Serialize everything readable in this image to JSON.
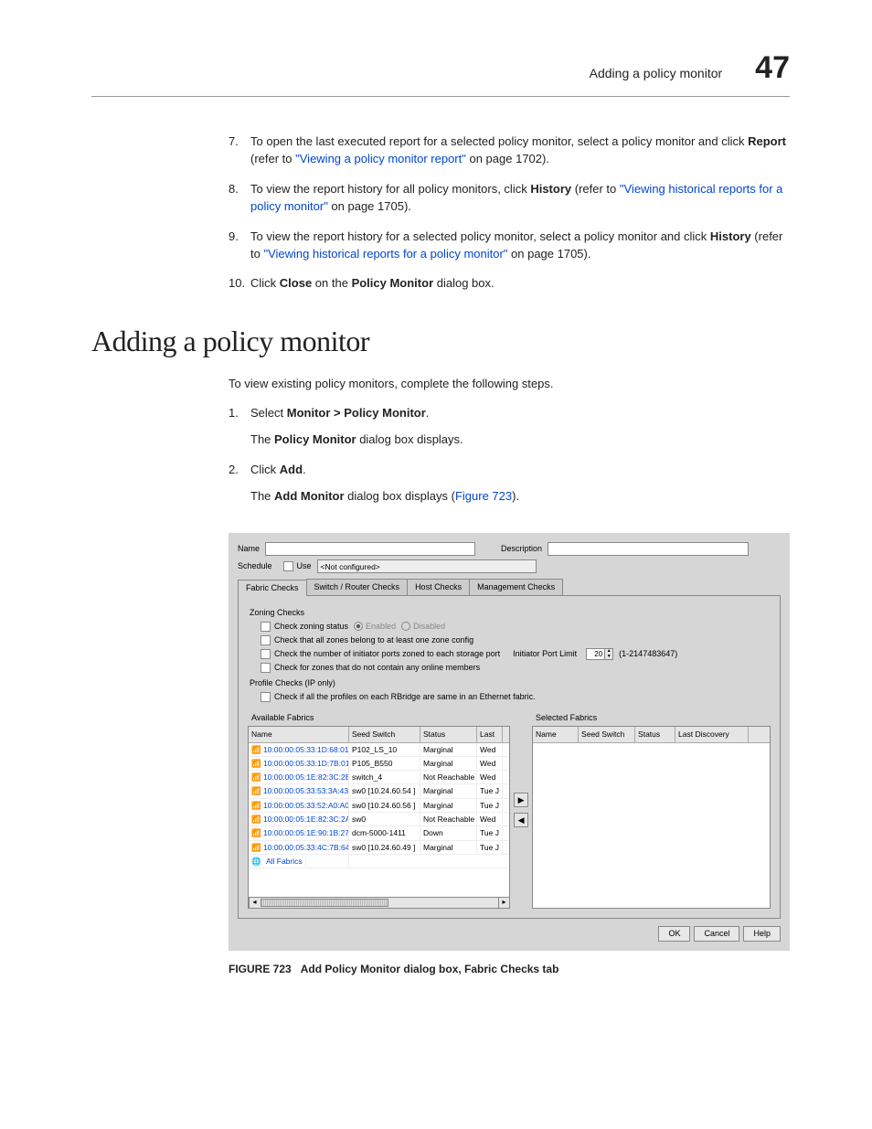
{
  "header": {
    "title": "Adding a policy monitor",
    "chapter": "47"
  },
  "steps_a": [
    {
      "num": "7.",
      "pre": "To open the last executed report for a selected policy monitor, select a policy monitor and click ",
      "b1": "Report",
      "mid": " (refer to ",
      "link": "\"Viewing a policy monitor report\"",
      "post": " on page 1702)."
    },
    {
      "num": "8.",
      "pre": "To view the report history for all policy monitors, click ",
      "b1": "History",
      "mid": " (refer to ",
      "link": "\"Viewing historical reports for a policy monitor\"",
      "post": " on page 1705)."
    },
    {
      "num": "9.",
      "pre": "To view the report history for a selected policy monitor, select a policy monitor and click ",
      "b1": "History",
      "mid": " (refer to ",
      "link": "\"Viewing historical reports for a policy monitor\"",
      "post": " on page 1705)."
    },
    {
      "num": "10.",
      "pre": "Click ",
      "b1": "Close",
      "mid": " on the ",
      "b2": "Policy Monitor",
      "post": " dialog box."
    }
  ],
  "section_title": "Adding a policy monitor",
  "intro": "To view existing policy monitors, complete the following steps.",
  "steps_b": [
    {
      "num": "1.",
      "pre": "Select ",
      "b1": "Monitor > Policy Monitor",
      "post": ".",
      "sub_pre": "The ",
      "sub_b": "Policy Monitor",
      "sub_post": " dialog box displays."
    },
    {
      "num": "2.",
      "pre": "Click ",
      "b1": "Add",
      "post": ".",
      "sub_pre": "The ",
      "sub_b": "Add Monitor",
      "sub_mid": " dialog box displays (",
      "sub_link": "Figure 723",
      "sub_post": ")."
    }
  ],
  "dialog": {
    "name_lbl": "Name",
    "desc_lbl": "Description",
    "sched_lbl": "Schedule",
    "use_lbl": "Use",
    "sched_val": "<Not configured>",
    "tabs": [
      "Fabric Checks",
      "Switch / Router Checks",
      "Host Checks",
      "Management Checks"
    ],
    "zoning_title": "Zoning Checks",
    "chk1": "Check zoning status",
    "enabled": "Enabled",
    "disabled": "Disabled",
    "chk2": "Check that all zones belong to at least one zone config",
    "chk3": "Check the number of initiator ports zoned to each storage port",
    "ipl_lbl": "Initiator Port Limit",
    "ipl_val": "20",
    "ipl_range": "(1-2147483647)",
    "chk4": "Check for zones that do not contain any online members",
    "profile_title": "Profile Checks (IP only)",
    "chk5": "Check if all the profiles on each RBridge are same in an Ethernet fabric.",
    "avail": "Available Fabrics",
    "sel": "Selected Fabrics",
    "cols_a": [
      "Name",
      "Seed Switch",
      "Status",
      "Last"
    ],
    "cols_b": [
      "Name",
      "Seed Switch",
      "Status",
      "Last Discovery"
    ],
    "rows": [
      {
        "name": "10:00:00:05:33:1D:68:01",
        "seed": "P102_LS_10",
        "status": "Marginal",
        "last": "Wed"
      },
      {
        "name": "10:00:00:05:33:1D:7B:01",
        "seed": "P105_B550",
        "status": "Marginal",
        "last": "Wed"
      },
      {
        "name": "10:00:00:05:1E:82:3C:2B",
        "seed": "switch_4",
        "status": "Not Reachable",
        "last": "Wed"
      },
      {
        "name": "10:00:00:05:33:53:3A:43",
        "seed": "sw0 [10.24.60.54 ]",
        "status": "Marginal",
        "last": "Tue J"
      },
      {
        "name": "10:00:00:05:33:52:A0:A0",
        "seed": "sw0 [10.24.60.56 ]",
        "status": "Marginal",
        "last": "Tue J"
      },
      {
        "name": "10:00:00:05:1E:82:3C:2A",
        "seed": "sw0",
        "status": "Not Reachable",
        "last": "Wed"
      },
      {
        "name": "10:00:00:05:1E:90:1B:27",
        "seed": "dcm-5000-1411",
        "status": "Down",
        "last": "Tue J"
      },
      {
        "name": "10:00:00:05:33:4C:7B:64",
        "seed": "sw0 [10.24.60.49 ]",
        "status": "Marginal",
        "last": "Tue J"
      }
    ],
    "all_fabrics": "All Fabrics",
    "buttons": {
      "ok": "OK",
      "cancel": "Cancel",
      "help": "Help"
    }
  },
  "figure": {
    "label": "FIGURE 723",
    "caption": "Add Policy Monitor dialog box, Fabric Checks tab"
  }
}
